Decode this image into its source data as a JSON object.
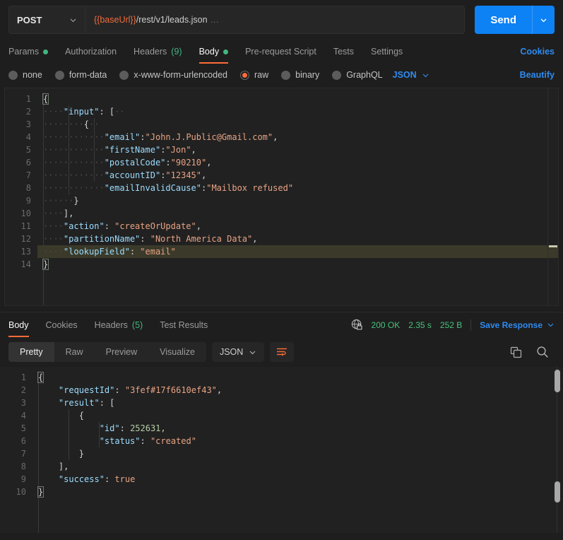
{
  "request": {
    "method": "POST",
    "url_variable": "{{baseUrl}}",
    "url_path": "/rest/v1/leads.json",
    "url_ellipsis": "…",
    "send_label": "Send",
    "tabs": [
      {
        "label": "Params",
        "dot": true,
        "active": false
      },
      {
        "label": "Authorization",
        "dot": false,
        "active": false
      },
      {
        "label": "Headers",
        "count": "(9)",
        "dot": false,
        "active": false
      },
      {
        "label": "Body",
        "dot": true,
        "active": true
      },
      {
        "label": "Pre-request Script",
        "dot": false,
        "active": false
      },
      {
        "label": "Tests",
        "dot": false,
        "active": false
      },
      {
        "label": "Settings",
        "dot": false,
        "active": false
      }
    ],
    "cookies_label": "Cookies",
    "body_types": [
      {
        "label": "none",
        "selected": false
      },
      {
        "label": "form-data",
        "selected": false
      },
      {
        "label": "x-www-form-urlencoded",
        "selected": false
      },
      {
        "label": "raw",
        "selected": true
      },
      {
        "label": "binary",
        "selected": false
      },
      {
        "label": "GraphQL",
        "selected": false
      }
    ],
    "language": "JSON",
    "beautify_label": "Beautify",
    "body_lines": [
      "1",
      "2",
      "3",
      "4",
      "5",
      "6",
      "7",
      "8",
      "9",
      "10",
      "11",
      "12",
      "13",
      "14"
    ],
    "body_code": {
      "l1": "{",
      "l2_key": "\"input\"",
      "l2_rest": ": [",
      "l3": "{",
      "l4_key": "\"email\"",
      "l4_val": "\"John.J.Public@Gmail.com\"",
      "l5_key": "\"firstName\"",
      "l5_val": "\"Jon\"",
      "l6_key": "\"postalCode\"",
      "l6_val": "\"90210\"",
      "l7_key": "\"accountID\"",
      "l7_val": "\"12345\"",
      "l8_key": "\"emailInvalidCause\"",
      "l8_val": "\"Mailbox refused\"",
      "l9": "}",
      "l10": "],",
      "l11_key": "\"action\"",
      "l11_val": "\"createOrUpdate\"",
      "l12_key": "\"partitionName\"",
      "l12_val": "\"North America Data\"",
      "l13_key": "\"lookupField\"",
      "l13_val": "\"email\"",
      "l14": "}"
    }
  },
  "response": {
    "tabs": [
      {
        "label": "Body",
        "active": true
      },
      {
        "label": "Cookies",
        "active": false
      },
      {
        "label": "Headers",
        "count": "(5)",
        "active": false
      },
      {
        "label": "Test Results",
        "active": false
      }
    ],
    "status_code": "200 OK",
    "time": "2.35 s",
    "size": "252 B",
    "save_label": "Save Response",
    "view_modes": [
      {
        "label": "Pretty",
        "active": true
      },
      {
        "label": "Raw",
        "active": false
      },
      {
        "label": "Preview",
        "active": false
      },
      {
        "label": "Visualize",
        "active": false
      }
    ],
    "language": "JSON",
    "body_lines": [
      "1",
      "2",
      "3",
      "4",
      "5",
      "6",
      "7",
      "8",
      "9",
      "10"
    ],
    "body_code": {
      "l1": "{",
      "l2_key": "\"requestId\"",
      "l2_val": "\"3fef#17f6610ef43\"",
      "l3_key": "\"result\"",
      "l3_rest": ": [",
      "l4": "{",
      "l5_key": "\"id\"",
      "l5_val": "252631,",
      "l6_key": "\"status\"",
      "l6_val": "\"created\"",
      "l7": "}",
      "l8": "],",
      "l9_key": "\"success\"",
      "l9_val": "true",
      "l10": "}"
    }
  },
  "colors": {
    "accent_orange": "#ff6c37",
    "link_blue": "#2e8bf0",
    "send_blue": "#0d82f5",
    "status_green": "#49c17d",
    "json_key": "#9cdcfe",
    "json_string": "#e8a384",
    "json_number": "#b5cea8"
  }
}
